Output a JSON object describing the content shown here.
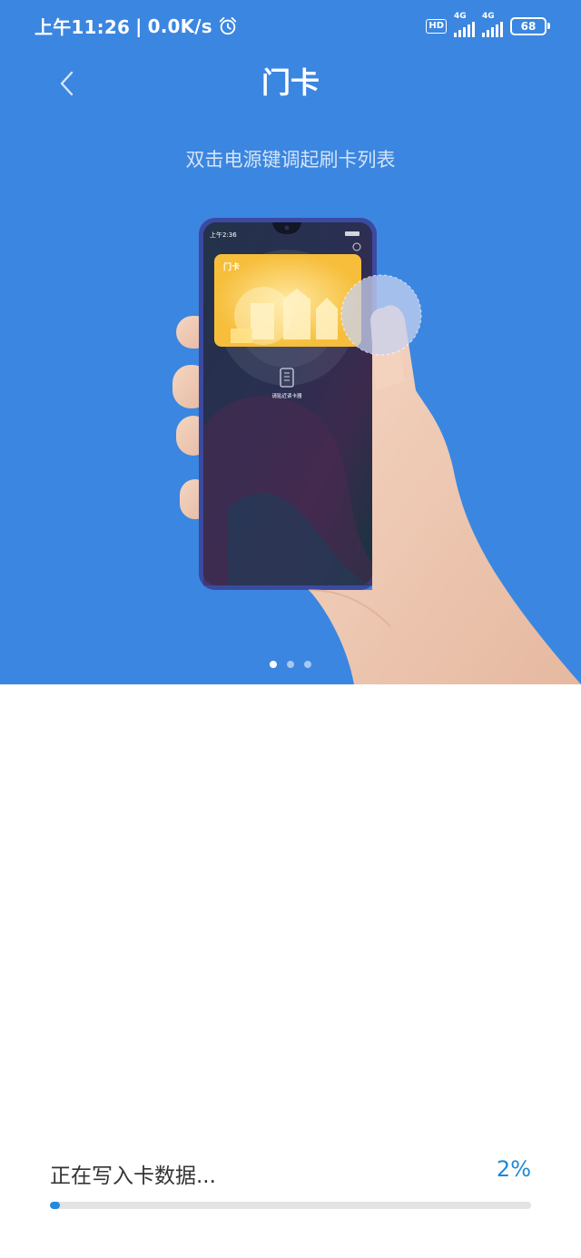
{
  "status_bar": {
    "time": "上午11:26",
    "separator": "|",
    "net_speed": "0.0K/s",
    "hd": "HD",
    "network_1": "4G",
    "network_2": "4G",
    "battery": "68"
  },
  "header": {
    "title": "门卡",
    "back_icon": "chevron-left-icon"
  },
  "instruction": "双击电源键调起刷卡列表",
  "illustration": {
    "phone_time": "上午2:36",
    "card_title": "门卡",
    "nfc_hint": "请贴近读卡器"
  },
  "carousel": {
    "page_count": 3,
    "active_index": 0
  },
  "progress": {
    "label": "正在写入卡数据...",
    "percent_text": "2%",
    "value": 0.02
  },
  "colors": {
    "hero_blue": "#3b86e0",
    "progress_blue": "#1e8ce0",
    "card_yellow": "#f7c54a"
  }
}
